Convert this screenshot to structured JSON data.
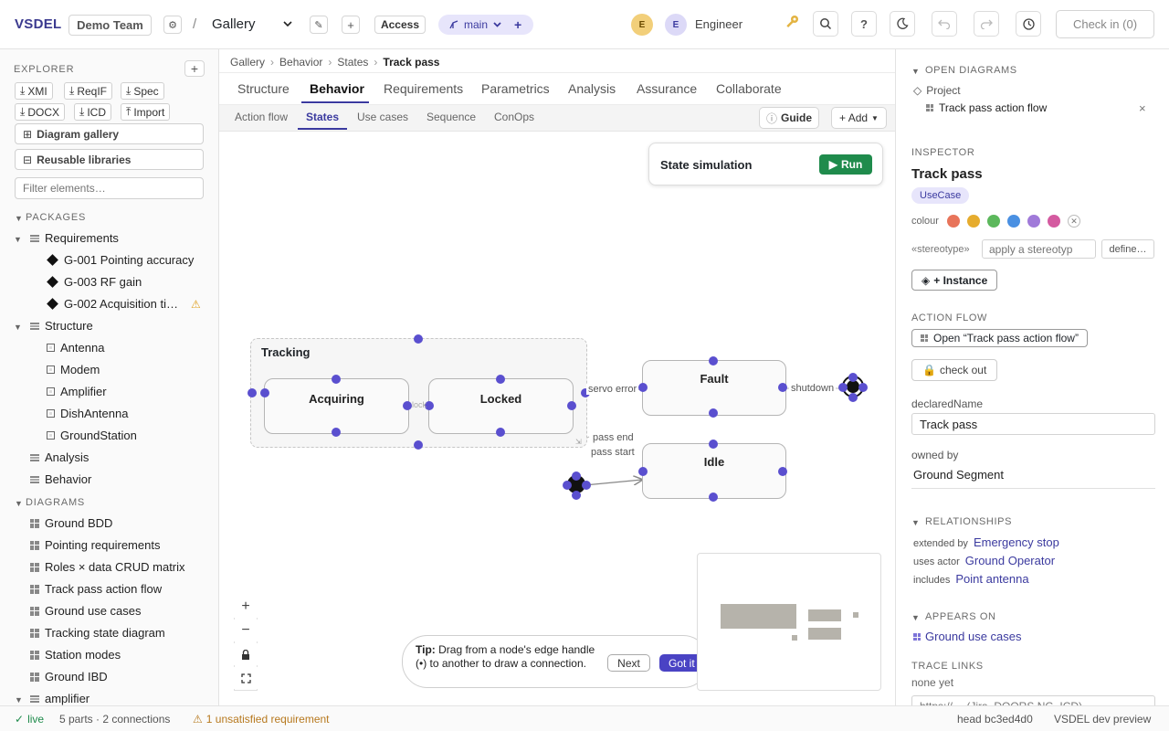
{
  "app": {
    "brand": "VSDEL"
  },
  "topbar": {
    "team": "Demo Team",
    "separator": "/",
    "project_select": "Gallery",
    "access_label": "Access",
    "branch": "main",
    "avatar1_initial": "E",
    "avatar2_initial": "E",
    "user_name": "Engineer",
    "help_label": "?",
    "checkin_label": "Check in (0)"
  },
  "explorer": {
    "title": "EXPLORER",
    "add": "+",
    "buttons": [
      "XMI",
      "ReqIF",
      "Spec",
      "DOCX",
      "ICD",
      "Import"
    ],
    "gallery_label": "Diagram gallery",
    "libraries_label": "Reusable libraries",
    "filter_placeholder": "Filter elements…",
    "packages_title": "PACKAGES",
    "requirements": {
      "label": "Requirements",
      "items": [
        "G-001 Pointing accuracy",
        "G-003 RF gain",
        "G-002 Acquisition ti…"
      ]
    },
    "structure": {
      "label": "Structure",
      "items": [
        "Antenna",
        "Modem",
        "Amplifier",
        "DishAntenna",
        "GroundStation"
      ]
    },
    "analysis_label": "Analysis",
    "behavior_label": "Behavior",
    "diagrams_title": "DIAGRAMS",
    "diagrams": [
      "Ground BDD",
      "Pointing requirements",
      "Roles × data CRUD matrix",
      "Track pass action flow",
      "Ground use cases",
      "Tracking state diagram",
      "Station modes",
      "Ground IBD"
    ],
    "partial_item": "amplifier"
  },
  "breadcrumb": {
    "items": [
      "Gallery",
      "Behavior",
      "States"
    ],
    "current": "Track pass",
    "sep": "›"
  },
  "tabs": [
    "Structure",
    "Behavior",
    "Requirements",
    "Parametrics",
    "Analysis",
    "Assurance",
    "Collaborate"
  ],
  "subtabs": [
    "Action flow",
    "States",
    "Use cases",
    "Sequence",
    "ConOps"
  ],
  "guide_label": "Guide",
  "add_label": "+ Add",
  "simulation": {
    "title": "State simulation",
    "run_label": "Run"
  },
  "diagram": {
    "composite": "Tracking",
    "states": {
      "acquiring": "Acquiring",
      "locked": "Locked",
      "fault": "Fault",
      "idle": "Idle"
    },
    "edges": {
      "servo_error": "servo error",
      "shutdown": "shutdown",
      "pass_end": "pass end",
      "pass_start": "pass start",
      "lock": "lock"
    }
  },
  "tip": {
    "bold": "Tip:",
    "text": "Drag from a node's edge handle (•) to another to draw a connection.",
    "next_label": "Next",
    "gotit_label": "Got it"
  },
  "right": {
    "open_diagrams_title": "OPEN DIAGRAMS",
    "project_label": "Project",
    "open_diagram": "Track pass action flow",
    "inspector_title": "INSPECTOR",
    "element_name": "Track pass",
    "element_type": "UseCase",
    "colour_label": "colour",
    "colours": [
      "#e8745a",
      "#e6ac2e",
      "#5cb85c",
      "#4a90e2",
      "#a07ad9",
      "#d45aa0"
    ],
    "stereotype_label": "«stereotype»",
    "stereotype_placeholder": "apply a stereotyp",
    "define_label": "define…",
    "instance_label": "+ Instance",
    "action_flow_title": "ACTION FLOW",
    "open_flow_label": "Open “Track pass action flow”",
    "checkout_label": "check out",
    "declared_name_label": "declaredName",
    "declared_name_value": "Track pass",
    "owned_by_label": "owned by",
    "owned_by_value": "Ground Segment",
    "relationships_title": "RELATIONSHIPS",
    "relationships": [
      {
        "kind": "extended by",
        "target": "Emergency stop"
      },
      {
        "kind": "uses actor",
        "target": "Ground Operator"
      },
      {
        "kind": "includes",
        "target": "Point antenna"
      }
    ],
    "appears_on_title": "APPEARS ON",
    "appears_on": "Ground use cases",
    "trace_links_title": "TRACE LINKS",
    "trace_none": "none yet",
    "trace_placeholder": "https://… (Jira, DOORS NG, ICD)"
  },
  "status": {
    "live": "live",
    "summary": "5 parts · 2 connections",
    "warning": "1 unsatisfied requirement",
    "head": "head bc3ed4d0",
    "env": "VSDEL dev preview"
  }
}
